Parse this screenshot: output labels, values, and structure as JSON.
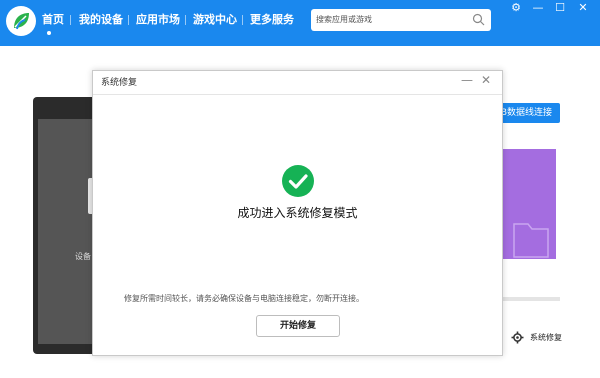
{
  "nav": {
    "items": [
      "首页",
      "我的设备",
      "应用市场",
      "游戏中心",
      "更多服务"
    ]
  },
  "search": {
    "placeholder": "搜索应用或游戏"
  },
  "window_controls": {
    "settings": "⚙",
    "minimize": "—",
    "maximize": "☐",
    "close": "✕"
  },
  "background": {
    "device_text": "设备",
    "usb_button": "B数据线连接",
    "repair_link": "系统修复"
  },
  "dialog": {
    "title": "系统修复",
    "minimize": "—",
    "close": "✕",
    "success_text": "成功进入系统修复模式",
    "note": "修复所需时间较长，请务必确保设备与电脑连接稳定，勿断开连接。",
    "start_button": "开始修复"
  },
  "colors": {
    "brand": "#1a88ee",
    "success": "#16b255",
    "promo": "#a46de0"
  }
}
